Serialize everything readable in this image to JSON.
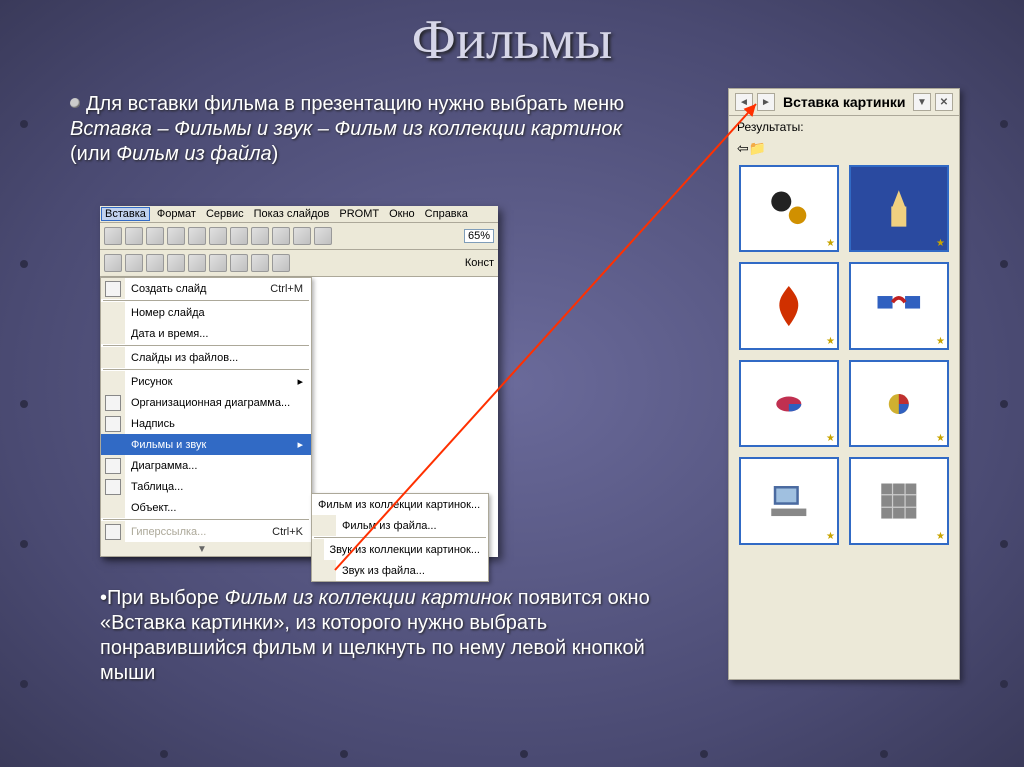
{
  "title": "Фильмы",
  "intro_plain": "Для вставки фильма в презентацию нужно выбрать меню ",
  "intro_italic": "Вставка – Фильмы и звук – Фильм из коллекции картинок ",
  "intro_tail": "(или ",
  "intro_tail_italic": "Фильм из файла",
  "intro_tail_close": ")",
  "menubar": {
    "items": [
      "Вставка",
      "Формат",
      "Сервис",
      "Показ слайдов",
      "PROMT",
      "Окно",
      "Справка"
    ],
    "active_index": 0
  },
  "toolbar_zoom": "65%",
  "toolbar_const": "Конст",
  "dropdown": {
    "items": [
      {
        "label": "Создать слайд",
        "accel": "Ctrl+M",
        "icon": true
      },
      {
        "sep": true
      },
      {
        "label": "Номер слайда",
        "icon": false
      },
      {
        "label": "Дата и время...",
        "icon": false
      },
      {
        "sep": true
      },
      {
        "label": "Слайды из файлов...",
        "icon": false
      },
      {
        "sep": true
      },
      {
        "label": "Рисунок",
        "arrow": true,
        "icon": false
      },
      {
        "label": "Организационная диаграмма...",
        "icon": true
      },
      {
        "label": "Надпись",
        "icon": true
      },
      {
        "label": "Фильмы и звук",
        "arrow": true,
        "hl": true
      },
      {
        "label": "Диаграмма...",
        "icon": true
      },
      {
        "label": "Таблица...",
        "icon": true
      },
      {
        "label": "Объект...",
        "icon": false
      },
      {
        "sep": true
      },
      {
        "label": "Гиперссылка...",
        "accel": "Ctrl+K",
        "icon": true,
        "disabled": true
      },
      {
        "chevrons": true
      }
    ]
  },
  "submenu": {
    "items": [
      "Фильм из коллекции картинок...",
      "Фильм из файла...",
      "",
      "Звук из коллекции картинок...",
      "Звук из файла..."
    ]
  },
  "note_lead": "•При выборе ",
  "note_italic": "Фильм из коллекции картинок ",
  "note_rest": "появится окно «Вставка картинки», из которого нужно выбрать понравившийся фильм и щелкнуть по нему левой кнопкой мыши",
  "pane": {
    "title": "Вставка картинки",
    "results_label": "Результаты:",
    "thumb_names": [
      "gears-icon",
      "chess-icon",
      "fire-icon",
      "network-icon",
      "pie-3d-icon",
      "pie-flat-icon",
      "computer-icon",
      "grid-icon"
    ]
  }
}
